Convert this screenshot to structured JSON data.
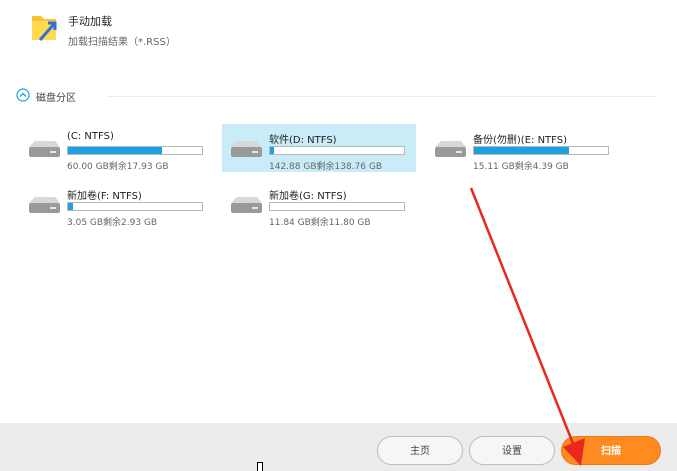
{
  "manual_load": {
    "title": "手动加载",
    "subtitle": "加载扫描结果（*.RSS）"
  },
  "section": {
    "title": "磁盘分区"
  },
  "drives": [
    {
      "name": "(C: NTFS)",
      "size": "60.00 GB剩余17.93 GB",
      "used_fraction": 0.7,
      "selected": false
    },
    {
      "name": "软件(D: NTFS)",
      "size": "142.88 GB剩余138.76 GB",
      "used_fraction": 0.03,
      "selected": true
    },
    {
      "name": "备份(勿删)(E: NTFS)",
      "size": "15.11 GB剩余4.39 GB",
      "used_fraction": 0.71,
      "selected": false
    },
    {
      "name": "新加卷(F: NTFS)",
      "size": "3.05 GB剩余2.93 GB",
      "used_fraction": 0.04,
      "selected": false
    },
    {
      "name": "新加卷(G: NTFS)",
      "size": "11.84 GB剩余11.80 GB",
      "used_fraction": 0.0,
      "selected": false
    }
  ],
  "buttons": {
    "home": "主页",
    "settings": "设置",
    "scan": "扫描"
  },
  "colors": {
    "accent": "#1e9fe0",
    "scan_button": "#ff8a1f",
    "selection": "#c9ecf8",
    "annotation_arrow": "#e8281e"
  }
}
